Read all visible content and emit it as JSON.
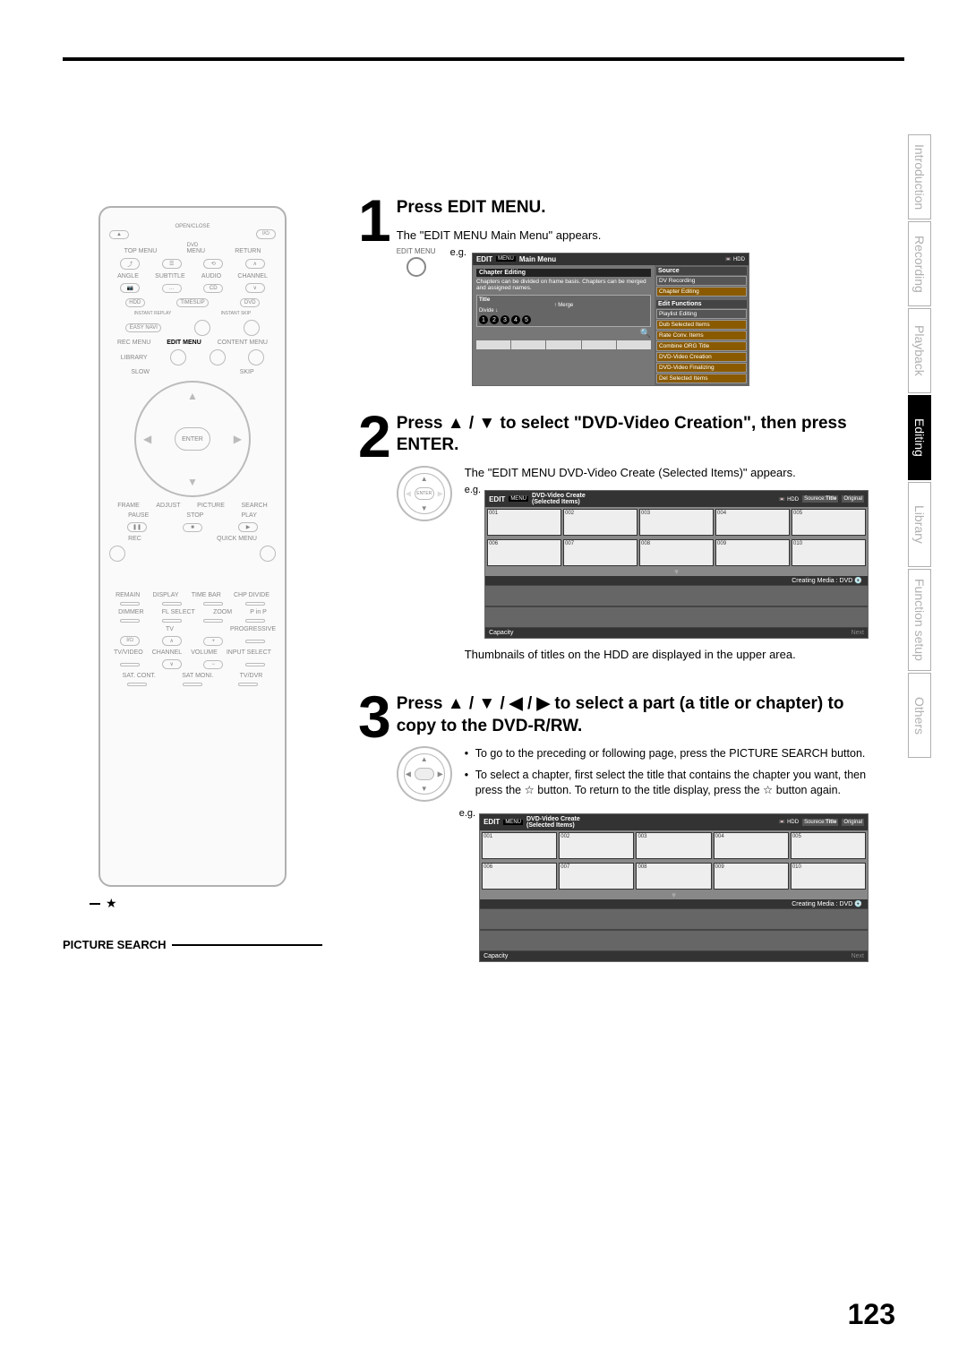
{
  "side_tabs": {
    "items": [
      {
        "label": "Introduction",
        "active": false
      },
      {
        "label": "Recording",
        "active": false
      },
      {
        "label": "Playback",
        "active": false
      },
      {
        "label": "Editing",
        "active": true
      },
      {
        "label": "Library",
        "active": false
      },
      {
        "label": "Function setup",
        "active": false
      },
      {
        "label": "Others",
        "active": false
      }
    ]
  },
  "page_number": "123",
  "picture_search_label": "PICTURE SEARCH",
  "star": "★",
  "star_outline": "☆",
  "steps": {
    "s1": {
      "num": "1",
      "title": "Press EDIT MENU.",
      "sub": "The \"EDIT MENU Main Menu\" appears.",
      "edit_menu_label": "EDIT MENU",
      "eg": "e.g.",
      "screen": {
        "logo_top": "EDIT",
        "logo_bot": "MENU",
        "title": "Main Menu",
        "hdd": "HDD",
        "source_hd": "Source",
        "source_items": [
          "DV Recording",
          "Chapter Editing"
        ],
        "desc": "Chapters can be divided on frame basis. Chapters can be merged and assigned names.",
        "section_title": "Title",
        "merge": "Merge",
        "divide": "Divide",
        "funcs_hd": "Edit Functions",
        "func_items": [
          "Playlist Editing",
          "Dub Selected Items",
          "Rate Conv. Items",
          "Combine ORG Title",
          "DVD-Video Creation",
          "DVD-Video Finalizing",
          "Del Selected Items"
        ],
        "chapter_editing": "Chapter Editing",
        "nums": [
          "1",
          "2",
          "3",
          "4",
          "5"
        ]
      }
    },
    "s2": {
      "num": "2",
      "title": "Press ▲ / ▼ to select \"DVD-Video Creation\", then press ENTER.",
      "sub": "The \"EDIT MENU DVD-Video Create (Selected Items)\" appears.",
      "eg": "e.g.",
      "enter_label": "ENTER",
      "after": "Thumbnails of titles on the HDD are displayed in the upper area.",
      "screen": {
        "logo_top": "EDIT",
        "logo_bot": "MENU",
        "title1": "DVD-Video Create",
        "title2": "(Selected Items)",
        "hdd": "HDD",
        "source": "Sourece:",
        "source_v": "Title",
        "original": "Original",
        "thumbs": [
          "001",
          "002",
          "003",
          "004",
          "005",
          "006",
          "007",
          "008",
          "009",
          "010"
        ],
        "creating": "Creating Media : DVD",
        "capacity": "Capacity",
        "next": "Next"
      }
    },
    "s3": {
      "num": "3",
      "title": "Press ▲ / ▼ / ◀ / ▶ to select a part (a title or chapter) to copy to the DVD-R/RW.",
      "bullets": [
        "To go to the preceding or following page, press the PICTURE SEARCH button.",
        "To select a chapter, first select the title that contains the chapter you want, then press the ☆ button. To return to the title display, press the ☆ button again."
      ],
      "eg": "e.g."
    }
  },
  "remote": {
    "row1": "OPEN/CLOSE",
    "dvd": "DVD",
    "topmenu": "TOP MENU",
    "menu": "MENU",
    "return": "RETURN",
    "angle": "ANGLE",
    "subtitle": "SUBTITLE",
    "audio": "AUDIO",
    "channel": "CHANNEL",
    "hdd": "HDD",
    "timeslip": "TIMESLIP",
    "dvdr": "DVD",
    "easy": "EASY NAVI",
    "instant_replay": "INSTANT REPLAY",
    "instant_skip": "INSTANT SKIP",
    "recmenu": "REC MENU",
    "editmenu": "EDIT MENU",
    "contentmenu": "CONTENT MENU",
    "library": "LIBRARY",
    "slow": "SLOW",
    "skip": "SKIP",
    "frame": "FRAME",
    "adjust": "ADJUST",
    "picture": "PICTURE",
    "search": "SEARCH",
    "enter": "ENTER",
    "pause": "PAUSE",
    "stop": "STOP",
    "play": "PLAY",
    "rec": "REC",
    "quick": "QUICK MENU",
    "remain": "REMAIN",
    "display": "DISPLAY",
    "timebar": "TIME BAR",
    "chpdiv": "CHP DIVIDE",
    "dimmer": "DIMMER",
    "flselect": "FL SELECT",
    "zoom": "ZOOM",
    "pinp": "P in P",
    "tv": "TV",
    "progressive": "PROGRESSIVE",
    "tvvideo": "TV/VIDEO",
    "channel2": "CHANNEL",
    "volume": "VOLUME",
    "inputsel": "INPUT SELECT",
    "satcont": "SAT. CONT.",
    "satmoni": "SAT MONI.",
    "tvdvr": "TV/DVR"
  }
}
